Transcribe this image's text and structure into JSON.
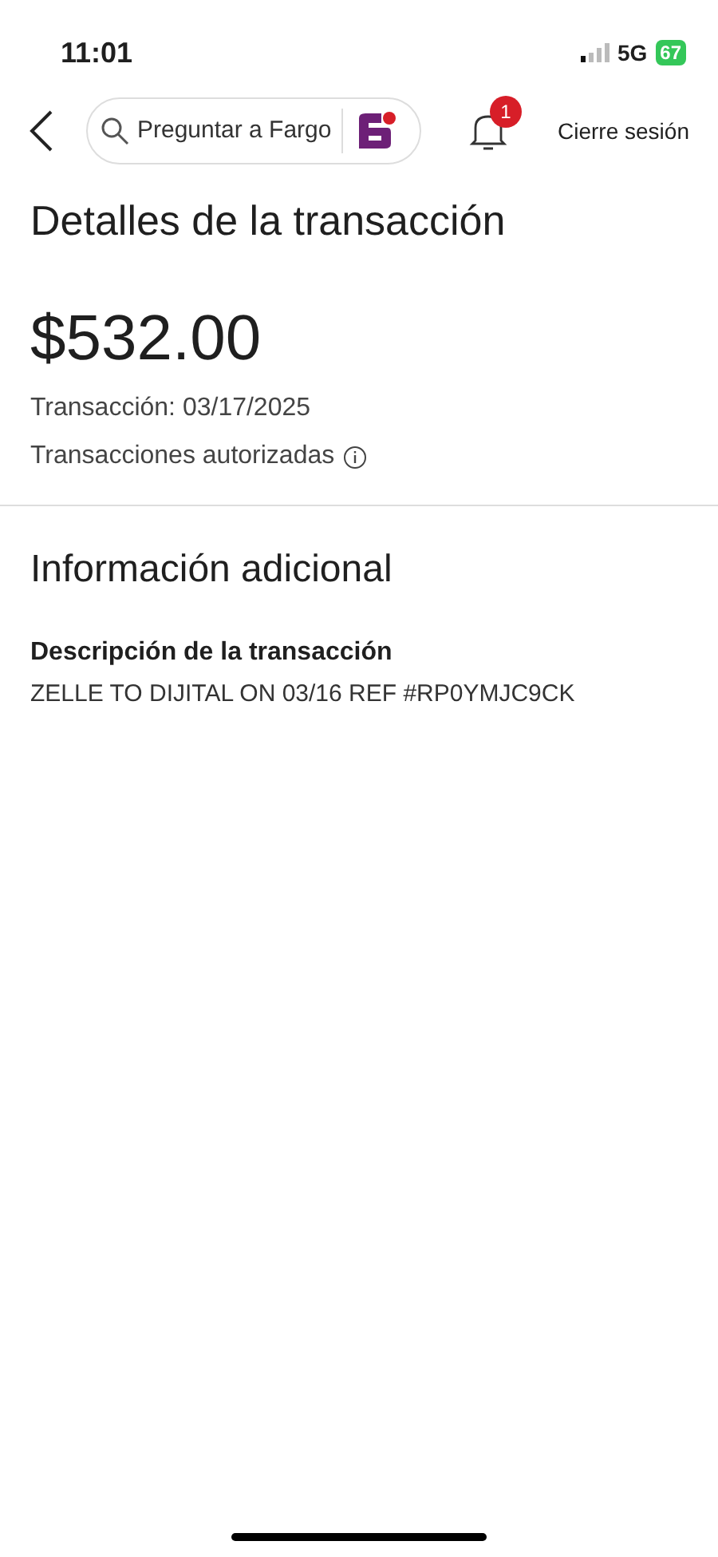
{
  "status_bar": {
    "time": "11:01",
    "network": "5G",
    "battery": "67"
  },
  "header": {
    "search": {
      "placeholder": "Preguntar a Fargo"
    },
    "notifications": {
      "badge": "1"
    },
    "logout": "Cierre sesión"
  },
  "title": "Detalles de la transacción",
  "amount": "$532.00",
  "date": "Transacción: 03/17/2025",
  "status": "Transacciones autorizadas",
  "section": {
    "title": "Información adicional",
    "label": "Descripción de la transacción",
    "value": "ZELLE TO DIJITAL ON 03/16 REF #RP0YMJC9CK"
  }
}
